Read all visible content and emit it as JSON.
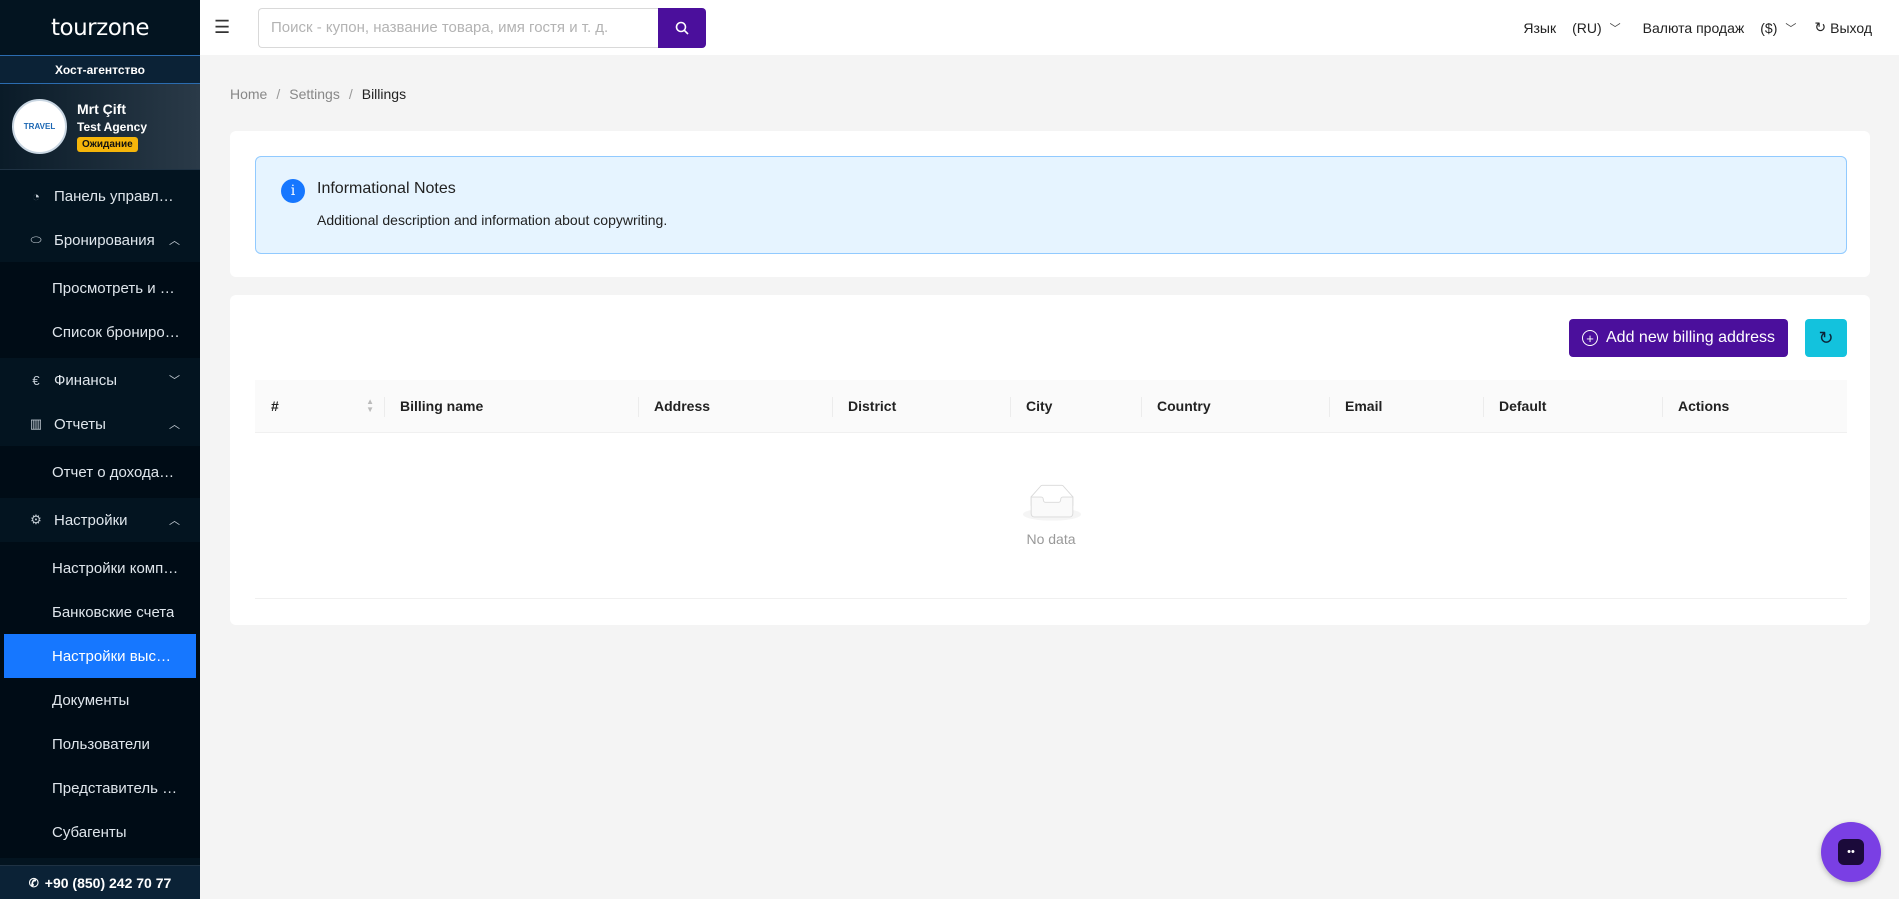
{
  "sidebar": {
    "logo": "tourzone",
    "agency_type": "Хост-агентство",
    "profile": {
      "name": "Mrt Çift",
      "agency": "Test Agency",
      "status": "Ожидание",
      "avatar_text": "TRAVEL"
    },
    "nav": {
      "dashboard": "Панель управления",
      "bookings": "Бронирования",
      "bookings_sub": [
        "Просмотреть и забронировать",
        "Список бронирований"
      ],
      "finance": "Финансы",
      "reports": "Отчеты",
      "reports_sub": [
        "Отчет о доходах и расходах"
      ],
      "settings": "Настройки",
      "settings_sub": [
        "Настройки компании",
        "Банковские счета",
        "Настройки выставления счетов",
        "Документы",
        "Пользователи",
        "Представитель продаж",
        "Субагенты"
      ]
    },
    "phone": "+90 (850) 242 70 77"
  },
  "header": {
    "search_placeholder": "Поиск - купон, название товара, имя гостя и т. д.",
    "language_label": "Язык",
    "language_value": "(RU)",
    "currency_label": "Валюта продаж",
    "currency_value": "($)",
    "logout": "Выход"
  },
  "breadcrumb": [
    "Home",
    "Settings",
    "Billings"
  ],
  "notes": {
    "title": "Informational Notes",
    "description": "Additional description and information about copywriting."
  },
  "billing": {
    "add_button": "Add new billing address",
    "columns": [
      "#",
      "Billing name",
      "Address",
      "District",
      "City",
      "Country",
      "Email",
      "Default",
      "Actions"
    ],
    "empty_text": "No data"
  },
  "colors": {
    "primary": "#4b0f9c",
    "sidebar_bg": "#031420",
    "active_item": "#1677ff",
    "refresh": "#13c2dd",
    "status_badge": "#f5b50a"
  }
}
